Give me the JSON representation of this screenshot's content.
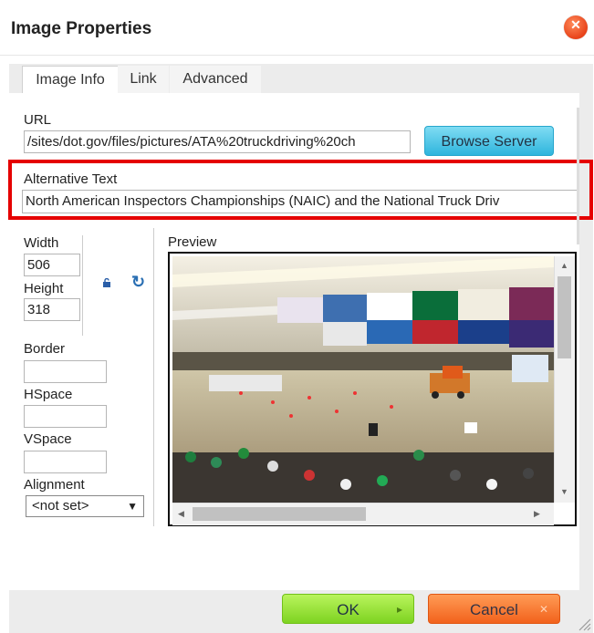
{
  "dialog": {
    "title": "Image Properties",
    "close_icon": "close-icon"
  },
  "tabs": [
    {
      "label": "Image Info",
      "active": true
    },
    {
      "label": "Link",
      "active": false
    },
    {
      "label": "Advanced",
      "active": false
    }
  ],
  "url": {
    "label": "URL",
    "value": "/sites/dot.gov/files/pictures/ATA%20truckdriving%20ch",
    "browse_label": "Browse Server"
  },
  "alt_text": {
    "label": "Alternative Text",
    "value": "North American Inspectors Championships (NAIC) and the National Truck Driv"
  },
  "dimensions": {
    "width_label": "Width",
    "width_value": "506",
    "height_label": "Height",
    "height_value": "318",
    "lock_icon": "lock-icon",
    "reset_icon": "reset-size-icon"
  },
  "spacing": {
    "border_label": "Border",
    "border_value": "",
    "hspace_label": "HSpace",
    "hspace_value": "",
    "vspace_label": "VSpace",
    "vspace_value": ""
  },
  "alignment": {
    "label": "Alignment",
    "selected": "<not set>"
  },
  "preview": {
    "label": "Preview"
  },
  "footer": {
    "ok_label": "OK",
    "cancel_label": "Cancel"
  },
  "colors": {
    "ok": "#7ed321",
    "cancel": "#f2621c",
    "browse": "#2fb5dd",
    "highlight": "#e50000",
    "close": "#e8431a"
  }
}
